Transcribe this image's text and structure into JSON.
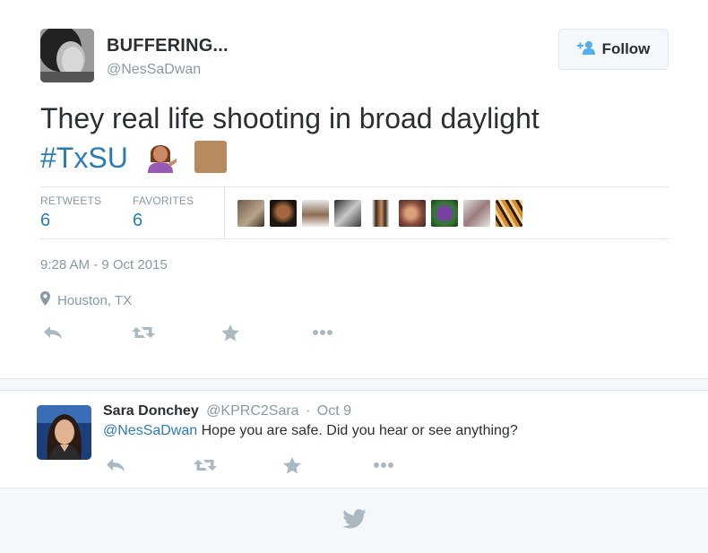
{
  "tweet": {
    "display_name": "BUFFERING...",
    "screen_name": "@NesSaDwan",
    "text_main": "They real life shooting in broad daylight",
    "hashtag": "#TxSU",
    "follow_label": "Follow",
    "stats": {
      "retweets_label": "RETWEETS",
      "retweets_count": "6",
      "favorites_label": "FAVORITES",
      "favorites_count": "6"
    },
    "timestamp": "9:28 AM - 9 Oct 2015",
    "location": "Houston, TX",
    "actions": [
      "reply-icon",
      "retweet-icon",
      "favorite-icon",
      "more-icon"
    ]
  },
  "reply": {
    "name": "Sara Donchey",
    "handle": "@KPRC2Sara",
    "separator": "·",
    "date": "Oct 9",
    "mention": "@NesSaDwan",
    "text": " Hope you are safe. Did you hear or see anything?"
  },
  "colors": {
    "link": "#2b7bb9",
    "muted": "#8899a6",
    "text": "#292f33",
    "border": "#e1e8ed",
    "background_alt": "#f5f8fa",
    "icon": "#aab8c2"
  },
  "footer": {
    "icon": "twitter-bird-icon"
  }
}
